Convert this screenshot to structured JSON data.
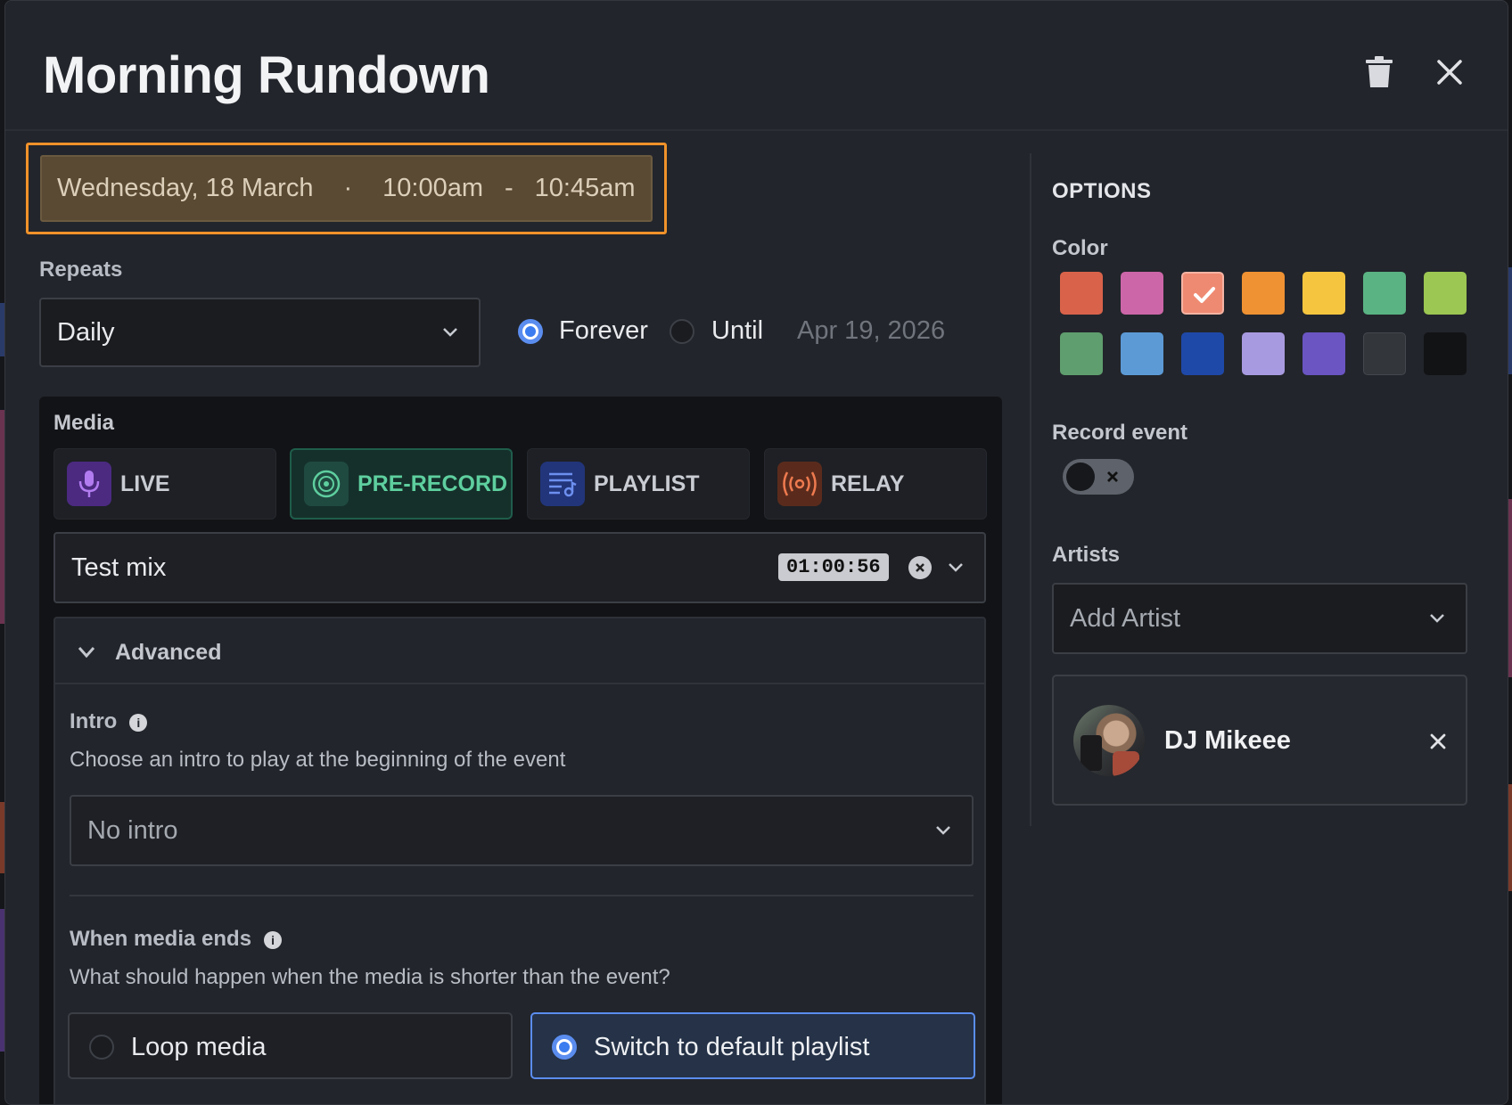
{
  "header": {
    "title": "Morning Rundown"
  },
  "datetime": {
    "date": "Wednesday, 18 March",
    "sep": "·",
    "start": "10:00am",
    "dash": "-",
    "end": "10:45am"
  },
  "repeats": {
    "label": "Repeats",
    "value": "Daily",
    "forever": "Forever",
    "until": "Until",
    "until_date": "Apr 19, 2026",
    "selected": "Forever"
  },
  "media": {
    "label": "Media",
    "types": [
      {
        "label": "LIVE",
        "icon": "microphone-icon",
        "active": false
      },
      {
        "label": "PRE-RECORD",
        "icon": "vinyl-record-icon",
        "active": true
      },
      {
        "label": "PLAYLIST",
        "icon": "playlist-icon",
        "active": false
      },
      {
        "label": "RELAY",
        "icon": "broadcast-icon",
        "active": false
      }
    ],
    "selected_file": "Test mix",
    "duration": "01:00:56"
  },
  "advanced": {
    "label": "Advanced",
    "intro": {
      "label": "Intro",
      "description": "Choose an intro to play at the beginning of the event",
      "value": "No intro"
    },
    "media_ends": {
      "label": "When media ends",
      "description": "What should happen when the media is shorter than the event?",
      "options": [
        "Loop media",
        "Switch to default playlist"
      ],
      "selected": "Switch to default playlist"
    }
  },
  "options": {
    "heading": "OPTIONS",
    "color_label": "Color",
    "colors": [
      "#d9634a",
      "#cc66a8",
      "#ef8a72",
      "#ef9233",
      "#f5c540",
      "#5ab383",
      "#9cc752",
      "#5f9e6e",
      "#5c9ad6",
      "#1f49a8",
      "#a89ae0",
      "#6a55c2",
      "#33363b",
      "#121315"
    ],
    "selected_color": "#ef8a72",
    "record_label": "Record event",
    "record_on": false,
    "artists_label": "Artists",
    "artists_placeholder": "Add Artist",
    "artists": [
      {
        "name": "DJ Mikeee"
      }
    ]
  }
}
